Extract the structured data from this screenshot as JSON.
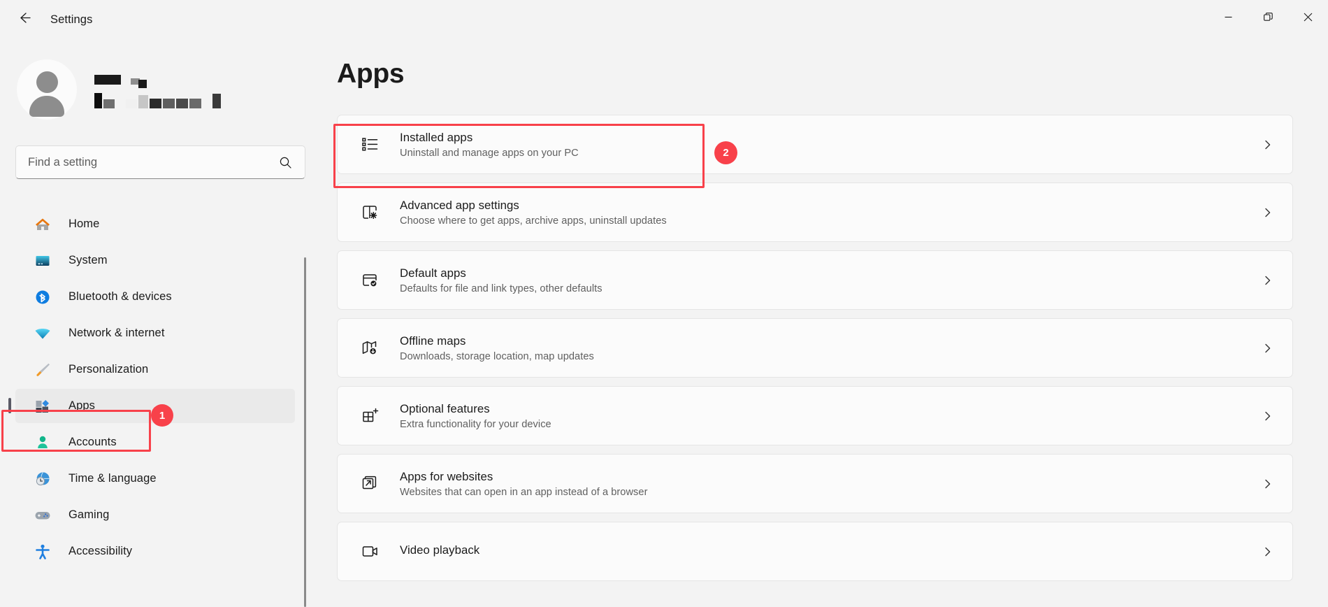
{
  "window": {
    "title": "Settings",
    "back_icon": "back-arrow-icon",
    "controls": {
      "minimize": "minimize-icon",
      "restore": "restore-icon",
      "close": "close-icon"
    }
  },
  "sidebar": {
    "account": {
      "avatar_icon": "user-avatar-icon",
      "name_redacted": true
    },
    "search": {
      "placeholder": "Find a setting",
      "value": "",
      "icon": "search-icon"
    },
    "items": [
      {
        "label": "Home",
        "icon": "home-icon",
        "selected": false
      },
      {
        "label": "System",
        "icon": "system-icon",
        "selected": false
      },
      {
        "label": "Bluetooth & devices",
        "icon": "bluetooth-icon",
        "selected": false
      },
      {
        "label": "Network & internet",
        "icon": "network-icon",
        "selected": false
      },
      {
        "label": "Personalization",
        "icon": "paintbrush-icon",
        "selected": false
      },
      {
        "label": "Apps",
        "icon": "apps-icon",
        "selected": true
      },
      {
        "label": "Accounts",
        "icon": "accounts-icon",
        "selected": false
      },
      {
        "label": "Time & language",
        "icon": "clock-globe-icon",
        "selected": false
      },
      {
        "label": "Gaming",
        "icon": "gamepad-icon",
        "selected": false
      },
      {
        "label": "Accessibility",
        "icon": "accessibility-icon",
        "selected": false
      }
    ]
  },
  "main": {
    "title": "Apps",
    "cards": [
      {
        "title": "Installed apps",
        "subtitle": "Uninstall and manage apps on your PC",
        "icon": "list-bullets-icon",
        "chevron": "chevron-right-icon"
      },
      {
        "title": "Advanced app settings",
        "subtitle": "Choose where to get apps, archive apps, uninstall updates",
        "icon": "app-gear-icon",
        "chevron": "chevron-right-icon"
      },
      {
        "title": "Default apps",
        "subtitle": "Defaults for file and link types, other defaults",
        "icon": "app-check-icon",
        "chevron": "chevron-right-icon"
      },
      {
        "title": "Offline maps",
        "subtitle": "Downloads, storage location, map updates",
        "icon": "map-download-icon",
        "chevron": "chevron-right-icon"
      },
      {
        "title": "Optional features",
        "subtitle": "Extra functionality for your device",
        "icon": "grid-plus-icon",
        "chevron": "chevron-right-icon"
      },
      {
        "title": "Apps for websites",
        "subtitle": "Websites that can open in an app instead of a browser",
        "icon": "external-link-icon",
        "chevron": "chevron-right-icon"
      },
      {
        "title": "Video playback",
        "subtitle": "",
        "icon": "video-icon",
        "chevron": "chevron-right-icon"
      }
    ]
  },
  "annotations": {
    "accent_color": "#f8414a",
    "badges": [
      {
        "label": "1",
        "target": "sidebar-item-apps"
      },
      {
        "label": "2",
        "target": "card-installed-apps"
      }
    ]
  }
}
